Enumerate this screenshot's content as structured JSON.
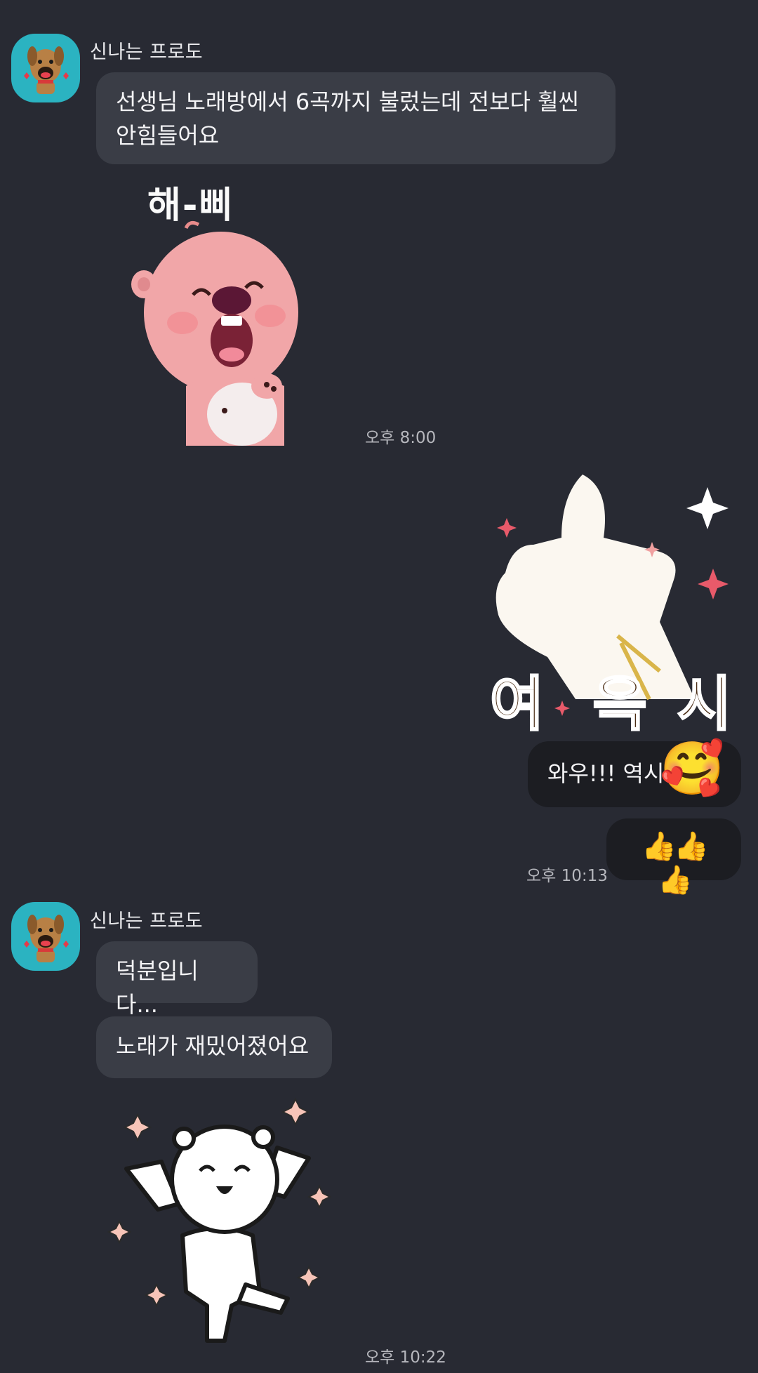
{
  "messages": {
    "m1": {
      "sender": "신나는 프로도",
      "line1": "선생님 노래방에서 6곡까지 불렀는데 전보다 훨씬",
      "line2": "안힘들어요"
    },
    "sticker1": {
      "caption": "해-삐",
      "time": "오후 8:00"
    },
    "sticker2": {
      "caption_left": "여 윽",
      "caption_right": "시"
    },
    "m2": {
      "text": "와우!!! 역시",
      "emoji": "🥰"
    },
    "m3": {
      "emoji": "👍👍👍",
      "time": "오후 10:13"
    },
    "m4": {
      "sender": "신나는 프로도",
      "text": "덕분입니다..."
    },
    "m5": {
      "text": "노래가 재밌어졌어요"
    },
    "sticker3": {
      "time": "오후 10:22"
    }
  },
  "colors": {
    "background": "#282a33",
    "incoming_bubble": "#3a3d46",
    "outgoing_bubble": "#1c1d22",
    "avatar_bg": "#2bb3c1"
  }
}
